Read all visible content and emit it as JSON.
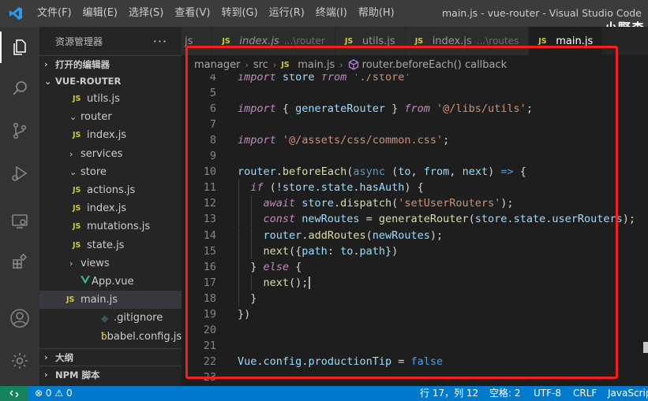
{
  "titlebar": {
    "menu": [
      "文件(F)",
      "编辑(E)",
      "选择(S)",
      "查看(V)",
      "转到(G)",
      "运行(R)",
      "终端(I)",
      "帮助(H)"
    ],
    "window_title": "main.js - vue-router - Visual Studio Code",
    "watermark": "小野森"
  },
  "activitybar": {
    "icons": [
      "explorer-icon",
      "search-icon",
      "source-control-icon",
      "run-debug-icon",
      "remote-explorer-icon",
      "extensions-icon",
      "account-icon",
      "settings-gear-icon"
    ]
  },
  "sidebar": {
    "title": "资源管理器",
    "more": "···",
    "open_editors": "打开的编辑器",
    "project": "VUE-ROUTER",
    "tree": [
      {
        "label": "utils.js",
        "type": "js",
        "indent": 2
      },
      {
        "label": "router",
        "type": "folder-open",
        "indent": 1
      },
      {
        "label": "index.js",
        "type": "js",
        "indent": 2
      },
      {
        "label": "services",
        "type": "folder",
        "indent": 1
      },
      {
        "label": "store",
        "type": "folder-open",
        "indent": 1
      },
      {
        "label": "actions.js",
        "type": "js",
        "indent": 2
      },
      {
        "label": "index.js",
        "type": "js",
        "indent": 2
      },
      {
        "label": "mutations.js",
        "type": "js",
        "indent": 2
      },
      {
        "label": "state.js",
        "type": "js",
        "indent": 2
      },
      {
        "label": "views",
        "type": "folder",
        "indent": 1
      },
      {
        "label": "App.vue",
        "type": "vue",
        "indent": 1
      },
      {
        "label": "main.js",
        "type": "js",
        "indent": 1,
        "selected": true
      },
      {
        "label": ".gitignore",
        "type": "git",
        "indent": 0
      },
      {
        "label": "babel.config.js",
        "type": "babel",
        "indent": 0
      }
    ],
    "outline": "大纲",
    "npm_scripts": "NPM 脚本"
  },
  "tabs": [
    {
      "label": "js",
      "path": "",
      "badge": "",
      "italic": false,
      "active": false
    },
    {
      "label": "index.js",
      "path": "...\\router",
      "badge": "JS",
      "italic": true,
      "active": false
    },
    {
      "label": "utils.js",
      "path": "",
      "badge": "JS",
      "italic": false,
      "active": false
    },
    {
      "label": "index.js",
      "path": "...\\routes",
      "badge": "JS",
      "italic": false,
      "active": false
    },
    {
      "label": "main.js",
      "path": "",
      "badge": "JS",
      "italic": false,
      "active": true
    }
  ],
  "breadcrumb": {
    "parts": [
      "manager",
      "src",
      "main.js",
      "router.beforeEach() callback"
    ],
    "js_badge": "JS"
  },
  "editor": {
    "lines": [
      {
        "n": "4",
        "tokens": [
          [
            "kc",
            "import"
          ],
          [
            "p",
            " "
          ],
          [
            "v",
            "store"
          ],
          [
            "p",
            " "
          ],
          [
            "kc",
            "from"
          ],
          [
            "p",
            " "
          ],
          [
            "s",
            "'./store'"
          ]
        ]
      },
      {
        "n": "5",
        "tokens": []
      },
      {
        "n": "6",
        "tokens": [
          [
            "kc",
            "import"
          ],
          [
            "p",
            " { "
          ],
          [
            "v",
            "generateRouter"
          ],
          [
            "p",
            " } "
          ],
          [
            "kc",
            "from"
          ],
          [
            "p",
            " "
          ],
          [
            "s",
            "'@/libs/utils'"
          ],
          [
            "p",
            ";"
          ]
        ]
      },
      {
        "n": "7",
        "tokens": []
      },
      {
        "n": "8",
        "tokens": [
          [
            "kc",
            "import"
          ],
          [
            "p",
            " "
          ],
          [
            "s",
            "'@/assets/css/common.css'"
          ],
          [
            "p",
            ";"
          ]
        ]
      },
      {
        "n": "9",
        "tokens": []
      },
      {
        "n": "10",
        "tokens": [
          [
            "v",
            "router"
          ],
          [
            "p",
            "."
          ],
          [
            "f",
            "beforeEach"
          ],
          [
            "p",
            "("
          ],
          [
            "k",
            "async"
          ],
          [
            "p",
            " ("
          ],
          [
            "v",
            "to"
          ],
          [
            "p",
            ", "
          ],
          [
            "v",
            "from"
          ],
          [
            "p",
            ", "
          ],
          [
            "v",
            "next"
          ],
          [
            "p",
            ") "
          ],
          [
            "k",
            "=>"
          ],
          [
            "p",
            " {"
          ]
        ]
      },
      {
        "n": "11",
        "tokens": [
          [
            "p",
            "  "
          ],
          [
            "kc",
            "if"
          ],
          [
            "p",
            " (!"
          ],
          [
            "v",
            "store"
          ],
          [
            "p",
            "."
          ],
          [
            "v",
            "state"
          ],
          [
            "p",
            "."
          ],
          [
            "v",
            "hasAuth"
          ],
          [
            "p",
            ") {"
          ]
        ]
      },
      {
        "n": "12",
        "tokens": [
          [
            "p",
            "    "
          ],
          [
            "kc",
            "await"
          ],
          [
            "p",
            " "
          ],
          [
            "v",
            "store"
          ],
          [
            "p",
            "."
          ],
          [
            "f",
            "dispatch"
          ],
          [
            "p",
            "("
          ],
          [
            "s",
            "'setUserRouters'"
          ],
          [
            "p",
            ");"
          ]
        ]
      },
      {
        "n": "13",
        "tokens": [
          [
            "p",
            "    "
          ],
          [
            "kc",
            "const"
          ],
          [
            "p",
            " "
          ],
          [
            "v",
            "newRoutes"
          ],
          [
            "p",
            " = "
          ],
          [
            "f",
            "generateRouter"
          ],
          [
            "p",
            "("
          ],
          [
            "v",
            "store"
          ],
          [
            "p",
            "."
          ],
          [
            "v",
            "state"
          ],
          [
            "p",
            "."
          ],
          [
            "v",
            "userRouters"
          ],
          [
            "p",
            ");"
          ]
        ]
      },
      {
        "n": "14",
        "tokens": [
          [
            "p",
            "    "
          ],
          [
            "v",
            "router"
          ],
          [
            "p",
            "."
          ],
          [
            "f",
            "addRoutes"
          ],
          [
            "p",
            "("
          ],
          [
            "v",
            "newRoutes"
          ],
          [
            "p",
            ");"
          ]
        ]
      },
      {
        "n": "15",
        "tokens": [
          [
            "p",
            "    "
          ],
          [
            "f",
            "next"
          ],
          [
            "p",
            "({"
          ],
          [
            "v",
            "path"
          ],
          [
            "p",
            ": "
          ],
          [
            "v",
            "to"
          ],
          [
            "p",
            "."
          ],
          [
            "v",
            "path"
          ],
          [
            "p",
            "})"
          ]
        ]
      },
      {
        "n": "16",
        "tokens": [
          [
            "p",
            "  } "
          ],
          [
            "kc",
            "else"
          ],
          [
            "p",
            " {"
          ]
        ]
      },
      {
        "n": "17",
        "tokens": [
          [
            "p",
            "    "
          ],
          [
            "f",
            "next"
          ],
          [
            "p",
            "();"
          ]
        ],
        "cursor": true
      },
      {
        "n": "18",
        "tokens": [
          [
            "p",
            "  }"
          ]
        ]
      },
      {
        "n": "19",
        "tokens": [
          [
            "p",
            "})"
          ]
        ]
      },
      {
        "n": "20",
        "tokens": []
      },
      {
        "n": "21",
        "tokens": []
      },
      {
        "n": "22",
        "tokens": [
          [
            "v",
            "Vue"
          ],
          [
            "p",
            "."
          ],
          [
            "v",
            "config"
          ],
          [
            "p",
            "."
          ],
          [
            "v",
            "productionTip"
          ],
          [
            "p",
            " = "
          ],
          [
            "k",
            "false"
          ]
        ]
      },
      {
        "n": "23",
        "tokens": []
      }
    ]
  },
  "statusbar": {
    "problems": "0",
    "warnings": "0",
    "position": "行 17，列 12",
    "spaces": "空格: 2",
    "encoding": "UTF-8",
    "eol": "CRLF",
    "language": "JavaScript"
  },
  "colors": {
    "accent": "#007acc",
    "highlight_box": "#f41f1f",
    "js_badge": "#cbcb41"
  }
}
